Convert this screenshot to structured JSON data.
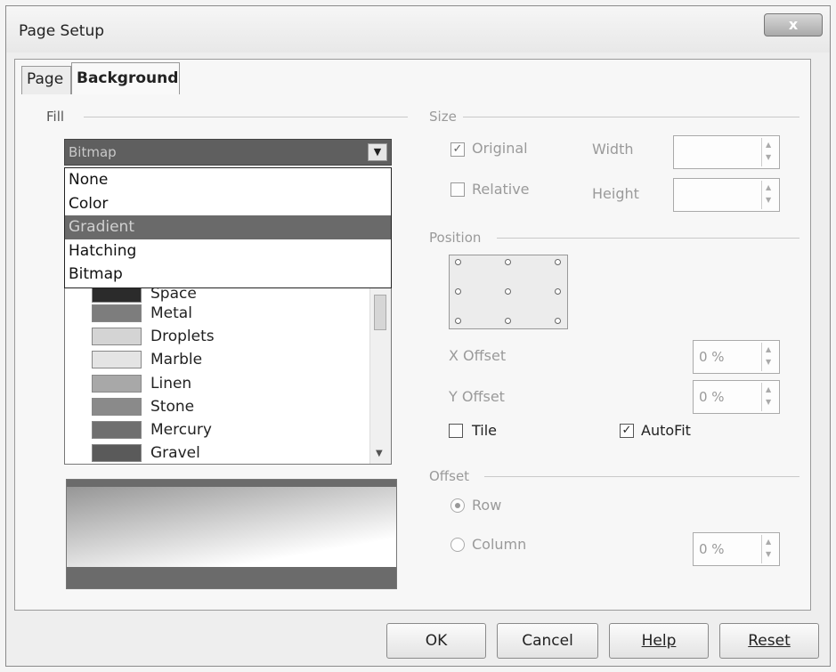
{
  "window": {
    "title": "Page Setup",
    "close_label": "x"
  },
  "tabs": [
    {
      "label": "Page"
    },
    {
      "label": "Background"
    }
  ],
  "fill": {
    "group_label": "Fill",
    "selected": "Bitmap",
    "options": [
      "None",
      "Color",
      "Gradient",
      "Hatching",
      "Bitmap"
    ],
    "highlighted": "Gradient",
    "bitmaps": [
      {
        "label": "Space",
        "color": "#2b2b2b"
      },
      {
        "label": "Metal",
        "color": "#7d7d7d"
      },
      {
        "label": "Droplets",
        "color": "#d4d4d4"
      },
      {
        "label": "Marble",
        "color": "#e4e4e4"
      },
      {
        "label": "Linen",
        "color": "#a8a8a8"
      },
      {
        "label": "Stone",
        "color": "#8a8a8a"
      },
      {
        "label": "Mercury",
        "color": "#6f6f6f"
      },
      {
        "label": "Gravel",
        "color": "#5a5a5a"
      }
    ]
  },
  "size": {
    "group_label": "Size",
    "original_label": "Original",
    "original_checked": true,
    "relative_label": "Relative",
    "relative_checked": false,
    "width_label": "Width",
    "height_label": "Height",
    "width_value": "",
    "height_value": ""
  },
  "position": {
    "group_label": "Position",
    "x_offset_label": "X Offset",
    "x_offset_value": "0 %",
    "y_offset_label": "Y Offset",
    "y_offset_value": "0 %",
    "tile_label": "Tile",
    "tile_checked": false,
    "autofit_label": "AutoFit",
    "autofit_checked": true
  },
  "offset": {
    "group_label": "Offset",
    "row_label": "Row",
    "column_label": "Column",
    "selected": "Row",
    "value": "0 %"
  },
  "buttons": {
    "ok": "OK",
    "cancel": "Cancel",
    "help": "Help",
    "reset": "Reset"
  }
}
